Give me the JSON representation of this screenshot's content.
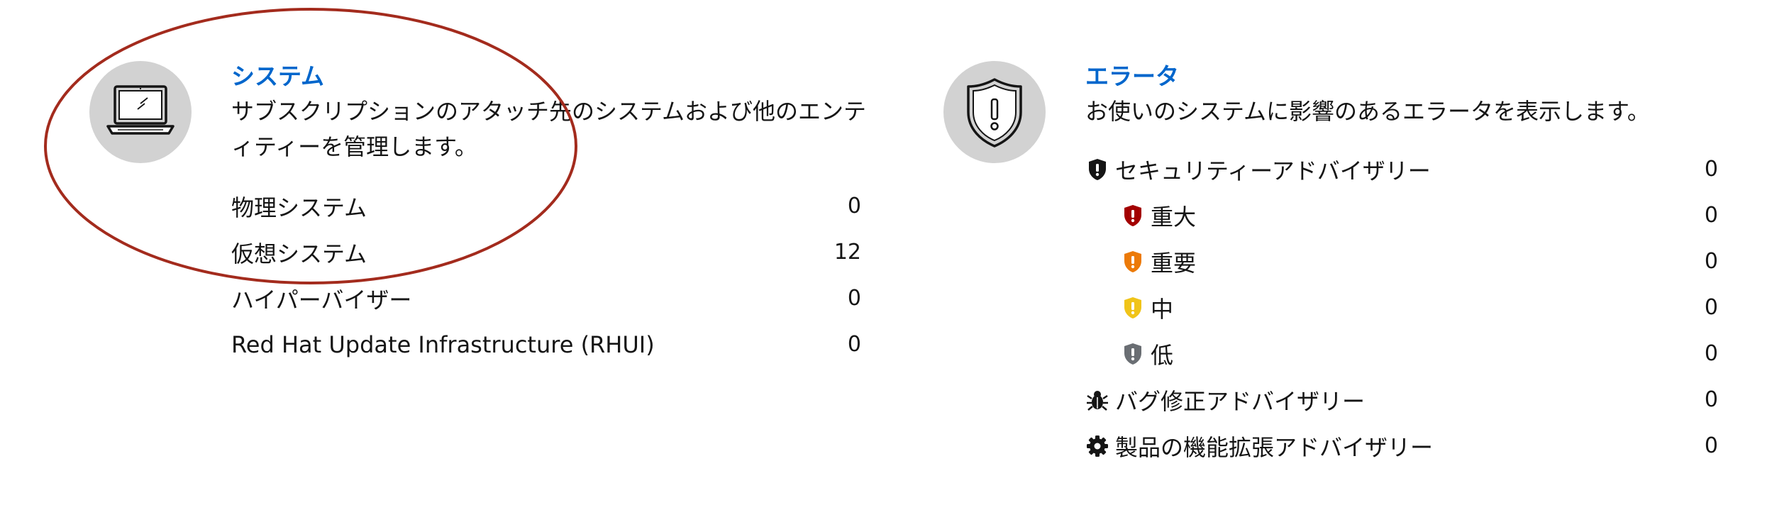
{
  "systems": {
    "title": "システム",
    "description": "サブスクリプションのアタッチ先のシステムおよび他のエンティティーを管理します。",
    "icon": "laptop-icon",
    "rows": [
      {
        "label": "物理システム",
        "count": "0"
      },
      {
        "label": "仮想システム",
        "count": "12"
      },
      {
        "label": "ハイパーバイザー",
        "count": "0"
      },
      {
        "label": "Red Hat Update Infrastructure (RHUI)",
        "count": "0"
      }
    ]
  },
  "errata": {
    "title": "エラータ",
    "description": "お使いのシステムに影響のあるエラータを表示します。",
    "icon": "shield-exclamation-icon",
    "rows": {
      "security": {
        "label": "セキュリティーアドバイザリー",
        "count": "0",
        "icon": "shield-exclamation-icon",
        "color": "#151515"
      },
      "critical": {
        "label": "重大",
        "count": "0",
        "icon": "shield-exclamation-icon",
        "color": "#a30000"
      },
      "important": {
        "label": "重要",
        "count": "0",
        "icon": "shield-exclamation-icon",
        "color": "#ec7a08"
      },
      "moderate": {
        "label": "中",
        "count": "0",
        "icon": "shield-exclamation-icon",
        "color": "#f0c419"
      },
      "low": {
        "label": "低",
        "count": "0",
        "icon": "shield-exclamation-icon",
        "color": "#6a6e73"
      },
      "bugfix": {
        "label": "バグ修正アドバイザリー",
        "count": "0",
        "icon": "bug-icon",
        "color": "#151515"
      },
      "enhancement": {
        "label": "製品の機能拡張アドバイザリー",
        "count": "0",
        "icon": "gear-icon",
        "color": "#151515"
      }
    }
  },
  "colors": {
    "link": "#0066cc",
    "icon_circle": "#d2d2d2",
    "annotation": "#a32b1d"
  }
}
